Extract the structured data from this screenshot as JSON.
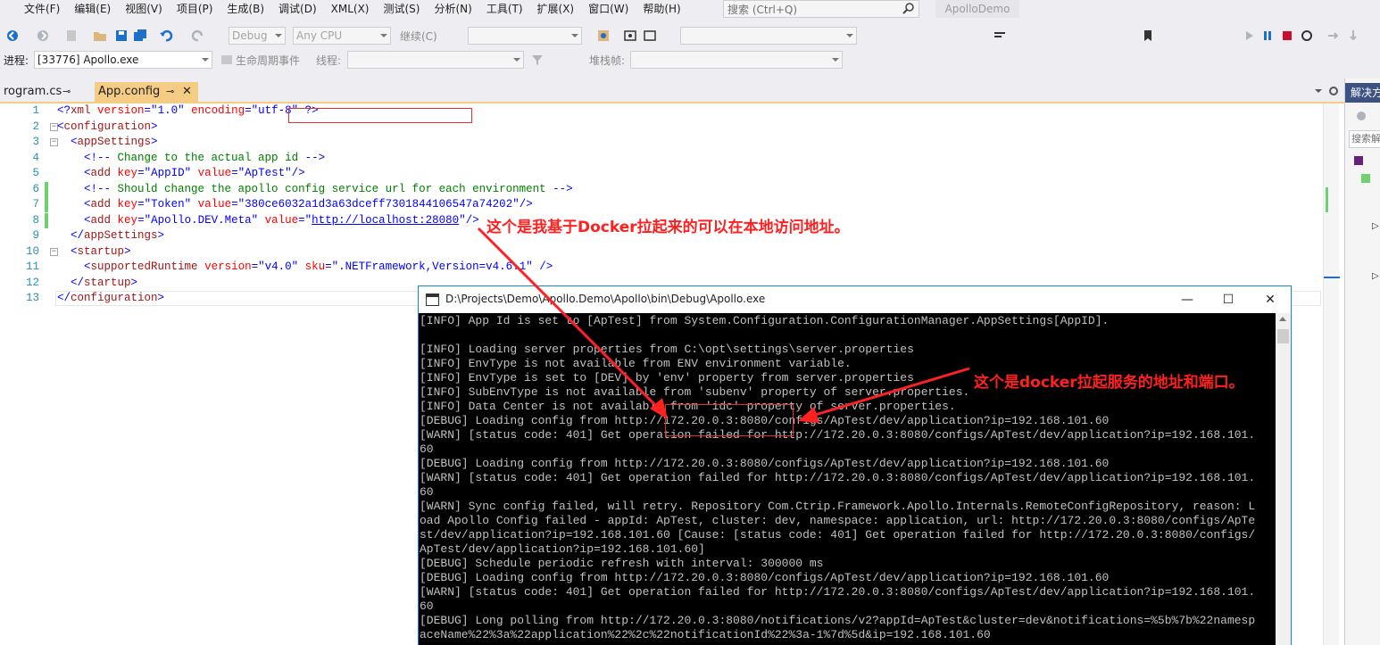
{
  "menubar": {
    "items": [
      "文件(F)",
      "编辑(E)",
      "视图(V)",
      "项目(P)",
      "生成(B)",
      "调试(D)",
      "XML(X)",
      "测试(S)",
      "分析(N)",
      "工具(T)",
      "扩展(X)",
      "窗口(W)",
      "帮助(H)"
    ],
    "search_placeholder": "搜索 (Ctrl+Q)",
    "solution_title": "ApolloDemo"
  },
  "toolbar": {
    "config": "Debug",
    "platform": "Any CPU",
    "continue_label": "继续(C)",
    "process_label": "进程:",
    "process_value": "[33776] Apollo.exe",
    "lifecycle_label": "生命周期事件",
    "thread_label": "线程:",
    "stackframe_label": "堆栈帧:"
  },
  "tabs": {
    "inactive": "rogram.cs",
    "active": "App.config",
    "pin": "⊸"
  },
  "editor": {
    "lines": [
      {
        "n": "1",
        "parts": [
          [
            "x-blue",
            "<?"
          ],
          [
            "x-mar",
            "xml"
          ],
          [
            "x-red",
            " version"
          ],
          [
            "x-blue",
            "=\""
          ],
          [
            "x-blue",
            "1.0"
          ],
          [
            "x-blue",
            "\""
          ],
          [
            "x-red",
            " encoding"
          ],
          [
            "x-blue",
            "=\""
          ],
          [
            "x-blue",
            "utf-8"
          ],
          [
            "x-blue",
            "\""
          ],
          [
            "x-blue",
            " ?>"
          ]
        ]
      },
      {
        "n": "2",
        "parts": [
          [
            "x-blue",
            "<"
          ],
          [
            "x-mar",
            "configuration"
          ],
          [
            "x-blue",
            ">"
          ]
        ]
      },
      {
        "n": "3",
        "parts": [
          [
            "x-blk",
            "  "
          ],
          [
            "x-blue",
            "<"
          ],
          [
            "x-mar",
            "appSettings"
          ],
          [
            "x-blue",
            ">"
          ]
        ]
      },
      {
        "n": "4",
        "parts": [
          [
            "x-blk",
            "    "
          ],
          [
            "x-blue",
            "<!--"
          ],
          [
            "x-green",
            " Change to the actual app id "
          ],
          [
            "x-blue",
            "-->"
          ]
        ]
      },
      {
        "n": "5",
        "parts": [
          [
            "x-blk",
            "    "
          ],
          [
            "x-blue",
            "<"
          ],
          [
            "x-mar",
            "add"
          ],
          [
            "x-red",
            " key"
          ],
          [
            "x-blue",
            "=\""
          ],
          [
            "x-blue",
            "AppID"
          ],
          [
            "x-blue",
            "\""
          ],
          [
            "x-red",
            " value"
          ],
          [
            "x-blue",
            "=\""
          ],
          [
            "x-blue",
            "ApTest"
          ],
          [
            "x-blue",
            "\"/>"
          ]
        ]
      },
      {
        "n": "6",
        "parts": [
          [
            "x-blk",
            "    "
          ],
          [
            "x-blue",
            "<!--"
          ],
          [
            "x-green",
            " Should change the apollo config service url for each environment "
          ],
          [
            "x-blue",
            "-->"
          ]
        ]
      },
      {
        "n": "7",
        "parts": [
          [
            "x-blk",
            "    "
          ],
          [
            "x-blue",
            "<"
          ],
          [
            "x-mar",
            "add"
          ],
          [
            "x-red",
            " key"
          ],
          [
            "x-blue",
            "=\""
          ],
          [
            "x-blue",
            "Token"
          ],
          [
            "x-blue",
            "\""
          ],
          [
            "x-red",
            " value"
          ],
          [
            "x-blue",
            "=\""
          ],
          [
            "x-blue",
            "380ce6032a1d3a63dceff7301844106547a74202"
          ],
          [
            "x-blue",
            "\"/>"
          ]
        ]
      },
      {
        "n": "8",
        "parts": [
          [
            "x-blk",
            "    "
          ],
          [
            "x-blue",
            "<"
          ],
          [
            "x-mar",
            "add"
          ],
          [
            "x-red",
            " key"
          ],
          [
            "x-blue",
            "=\""
          ],
          [
            "x-blue",
            "Apollo.DEV.Meta"
          ],
          [
            "x-blue",
            "\""
          ],
          [
            "x-red",
            " value"
          ],
          [
            "x-blue",
            "=\""
          ],
          [
            "x-link",
            "http://localhost:28080"
          ],
          [
            "x-blue",
            "\"/>"
          ]
        ]
      },
      {
        "n": "9",
        "parts": [
          [
            "x-blk",
            "  "
          ],
          [
            "x-blue",
            "</"
          ],
          [
            "x-mar",
            "appSettings"
          ],
          [
            "x-blue",
            ">"
          ]
        ]
      },
      {
        "n": "10",
        "parts": [
          [
            "x-blk",
            "  "
          ],
          [
            "x-blue",
            "<"
          ],
          [
            "x-mar",
            "startup"
          ],
          [
            "x-blue",
            ">"
          ]
        ]
      },
      {
        "n": "11",
        "parts": [
          [
            "x-blk",
            "    "
          ],
          [
            "x-blue",
            "<"
          ],
          [
            "x-mar",
            "supportedRuntime"
          ],
          [
            "x-red",
            " version"
          ],
          [
            "x-blue",
            "=\""
          ],
          [
            "x-blue",
            "v4.0"
          ],
          [
            "x-blue",
            "\""
          ],
          [
            "x-red",
            " sku"
          ],
          [
            "x-blue",
            "=\""
          ],
          [
            "x-blue",
            ".NETFramework,Version=v4.6.1"
          ],
          [
            "x-blue",
            "\""
          ],
          [
            "x-blue",
            " />"
          ]
        ]
      },
      {
        "n": "12",
        "parts": [
          [
            "x-blk",
            "  "
          ],
          [
            "x-blue",
            "</"
          ],
          [
            "x-mar",
            "startup"
          ],
          [
            "x-blue",
            ">"
          ]
        ]
      },
      {
        "n": "13",
        "parts": [
          [
            "x-blue",
            "</"
          ],
          [
            "x-mar",
            "configuration"
          ],
          [
            "x-blue",
            ">"
          ]
        ]
      }
    ]
  },
  "console": {
    "title": "D:\\Projects\\Demo\\Apollo.Demo\\Apollo\\bin\\Debug\\Apollo.exe",
    "minimize": "—",
    "maximize": "☐",
    "close": "✕",
    "lines": [
      "[INFO] App Id is set to [ApTest] from System.Configuration.ConfigurationManager.AppSettings[AppID].",
      "",
      "[INFO] Loading server properties from C:\\opt\\settings\\server.properties",
      "[INFO] EnvType is not available from ENV environment variable.",
      "[INFO] EnvType is set to [DEV] by 'env' property from server.properties",
      "[INFO] SubEnvType is not available from 'subenv' property of server.properties.",
      "[INFO] Data Center is not available from 'idc' property of server.properties.",
      "[DEBUG] Loading config from http://172.20.0.3:8080/configs/ApTest/dev/application?ip=192.168.101.60",
      "[WARN] [status code: 401] Get operation failed for http://172.20.0.3:8080/configs/ApTest/dev/application?ip=192.168.101.",
      "60",
      "[DEBUG] Loading config from http://172.20.0.3:8080/configs/ApTest/dev/application?ip=192.168.101.60",
      "[WARN] [status code: 401] Get operation failed for http://172.20.0.3:8080/configs/ApTest/dev/application?ip=192.168.101.",
      "60",
      "[WARN] Sync config failed, will retry. Repository Com.Ctrip.Framework.Apollo.Internals.RemoteConfigRepository, reason: L",
      "oad Apollo Config failed - appId: ApTest, cluster: dev, namespace: application, url: http://172.20.0.3:8080/configs/ApTe",
      "st/dev/application?ip=192.168.101.60 [Cause: [status code: 401] Get operation failed for http://172.20.0.3:8080/configs/",
      "ApTest/dev/application?ip=192.168.101.60]",
      "[DEBUG] Schedule periodic refresh with interval: 300000 ms",
      "[DEBUG] Loading config from http://172.20.0.3:8080/configs/ApTest/dev/application?ip=192.168.101.60",
      "[WARN] [status code: 401] Get operation failed for http://172.20.0.3:8080/configs/ApTest/dev/application?ip=192.168.101.",
      "60",
      "[DEBUG] Long polling from http://172.20.0.3:8080/notifications/v2?appId=ApTest&cluster=dev&notifications=%5b%7b%22namesp",
      "aceName%22%3a%22application%22%2c%22notificationId%22%3a-1%7d%5d&ip=192.168.101.60"
    ]
  },
  "annotations": {
    "local_address": "这个是我基于Docker拉起来的可以在本地访问地址。",
    "docker_address": "这个是docker拉起服务的地址和端口。"
  },
  "right_panel": {
    "header": "解决方",
    "search": "搜索解"
  },
  "colors": {
    "tab_active": "#f5cc84",
    "annotation": "#ff2020",
    "console_bg": "#000000",
    "console_text": "#c0c0c0"
  }
}
